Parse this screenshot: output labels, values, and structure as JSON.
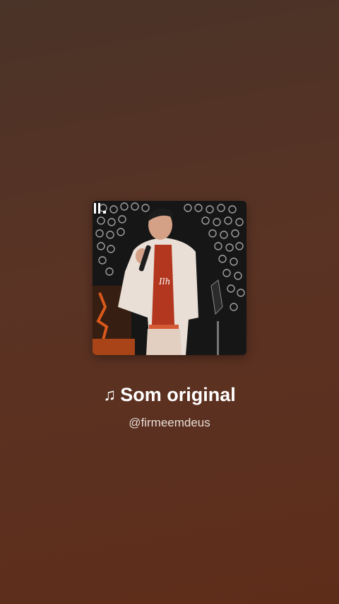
{
  "audio": {
    "title": "Som original",
    "author": "@firmeemdeus",
    "icon": "music-note-icon",
    "cover_brand_mark": "Ilh",
    "cover_shirt_text": "Ilh"
  },
  "colors": {
    "background_top": "#4a3328",
    "background_bottom": "#5e2d1a",
    "title": "#ffffff",
    "author": "#e6dcd6"
  }
}
